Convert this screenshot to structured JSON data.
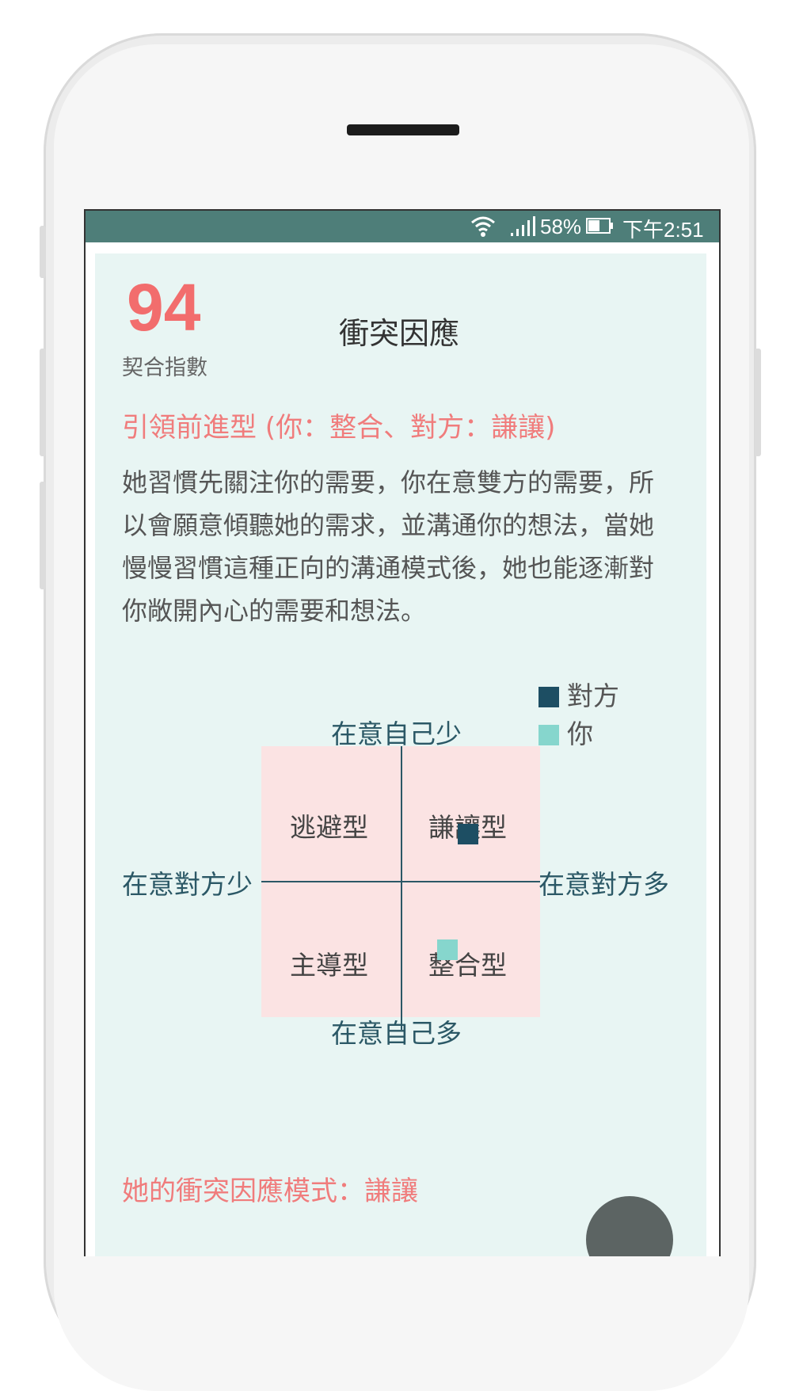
{
  "status_bar": {
    "battery_pct": "58%",
    "time": "下午2:51",
    "color": "#4e7e79"
  },
  "header": {
    "score": "94",
    "score_label": "契合指數",
    "title": "衝突因應"
  },
  "result": {
    "type_heading": "引領前進型 (你：整合、對方：謙讓)",
    "description": "她習慣先關注你的需要，你在意雙方的需要，所以會願意傾聽她的需求，並溝通你的想法，當她慢慢習慣這種正向的溝通模式後，她也能逐漸對你敞開內心的需要和想法。"
  },
  "legend": {
    "other_label": "對方",
    "other_color": "#1d4e63",
    "you_label": "你",
    "you_color": "#86d6cd"
  },
  "quadrant": {
    "axis_top": "在意自己少",
    "axis_bottom": "在意自己多",
    "axis_left": "在意對方少",
    "axis_right": "在意對方多",
    "top_left": "逃避型",
    "top_right": "謙讓型",
    "bottom_left": "主導型",
    "bottom_right": "整合型",
    "background_color": "#fbe3e3"
  },
  "footer": {
    "her_mode": "她的衝突因應模式：謙讓"
  },
  "icons": [
    "wifi-icon",
    "signal-icon",
    "battery-icon",
    "fab-button"
  ]
}
